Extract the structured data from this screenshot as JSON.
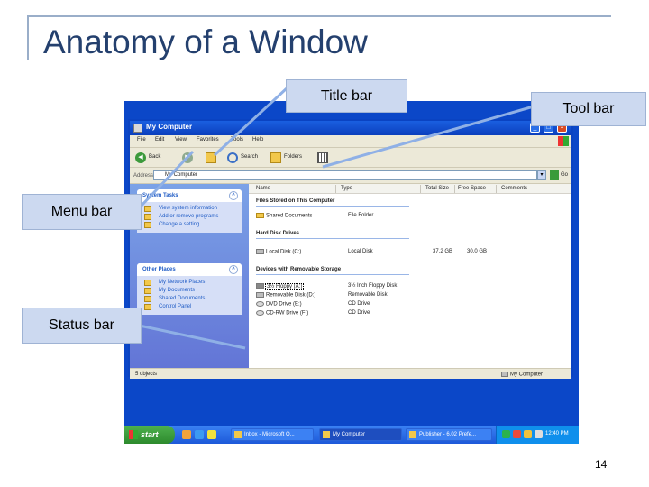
{
  "slide": {
    "title": "Anatomy of a Window",
    "page_number": "14"
  },
  "callouts": {
    "title_bar": "Title bar",
    "tool_bar": "Tool bar",
    "menu_bar": "Menu bar",
    "status_bar": "Status bar"
  },
  "window": {
    "title": "My Computer",
    "menu": [
      "File",
      "Edit",
      "View",
      "Favorites",
      "Tools",
      "Help"
    ],
    "toolbar": {
      "back": "Back",
      "search": "Search",
      "folders": "Folders"
    },
    "address": {
      "label": "Address",
      "value": "My Computer",
      "go": "Go"
    },
    "system_tasks": {
      "title": "System Tasks",
      "items": [
        "View system information",
        "Add or remove programs",
        "Change a setting"
      ]
    },
    "other_places": {
      "title": "Other Places",
      "items": [
        "My Network Places",
        "My Documents",
        "Shared Documents",
        "Control Panel"
      ]
    },
    "columns": [
      "Name",
      "Type",
      "Total Size",
      "Free Space",
      "Comments"
    ],
    "groups": [
      {
        "title": "Files Stored on This Computer",
        "rows": [
          {
            "name": "Shared Documents",
            "type": "File Folder",
            "total": "",
            "free": ""
          }
        ]
      },
      {
        "title": "Hard Disk Drives",
        "rows": [
          {
            "name": "Local Disk (C:)",
            "type": "Local Disk",
            "total": "37.2 GB",
            "free": "30.0 GB"
          }
        ]
      },
      {
        "title": "Devices with Removable Storage",
        "rows": [
          {
            "name": "3½ Floppy (A:)",
            "type": "3½ Inch Floppy Disk",
            "total": "",
            "free": ""
          },
          {
            "name": "Removable Disk (D:)",
            "type": "Removable Disk",
            "total": "",
            "free": ""
          },
          {
            "name": "DVD Drive (E:)",
            "type": "CD Drive",
            "total": "",
            "free": ""
          },
          {
            "name": "CD-RW Drive (F:)",
            "type": "CD Drive",
            "total": "",
            "free": ""
          }
        ]
      }
    ],
    "status": {
      "left": "5 objects",
      "right": "My Computer"
    }
  },
  "taskbar": {
    "start": "start",
    "buttons": [
      "Inbox - Microsoft O...",
      "My Computer",
      "Publisher - 6.02 Prefe..."
    ],
    "clock": "12:40 PM"
  },
  "colors": {
    "title": "#24406e",
    "callout_fill": "#ccd9f0",
    "leader_line": "#8fb0e6",
    "xp_blue": "#0b47c8"
  }
}
